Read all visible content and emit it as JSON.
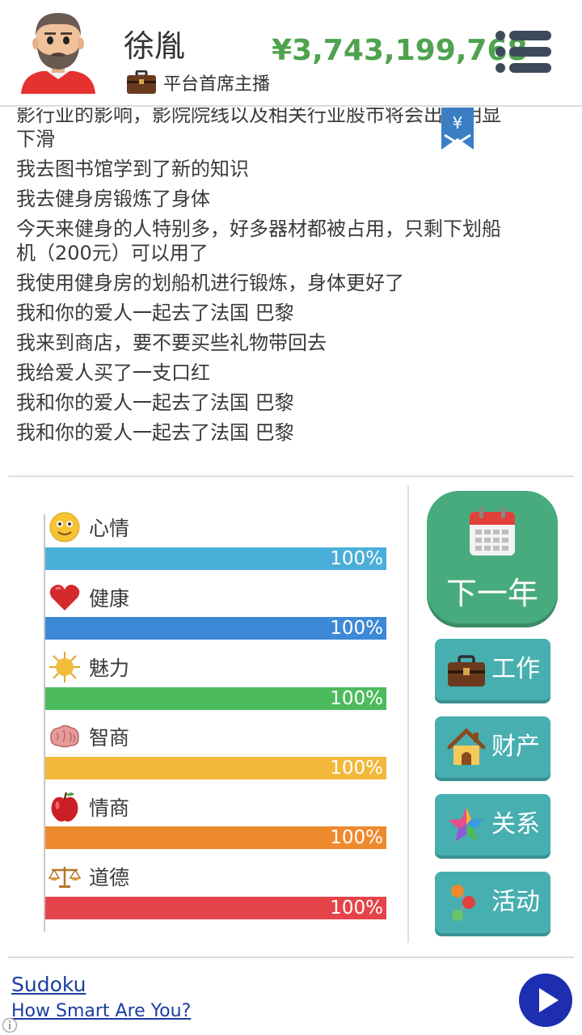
{
  "header": {
    "player_name": "徐胤",
    "job_title": "平台首席主播",
    "money": "¥3,743,199,768",
    "icons": {
      "avatar": "bearded-man-avatar",
      "briefcase": "briefcase-icon",
      "menu": "hamburger-menu-icon"
    },
    "colors": {
      "money": "#4fa34f"
    }
  },
  "log": {
    "lines": [
      "影行业的影响，影院院线以及相关行业股市将会出现明显",
      "下滑",
      "我去图书馆学到了新的知识",
      "我去健身房锻炼了身体",
      "今天来健身的人特别多，好多器材都被占用，只剩下划船",
      "机（200元）可以用了",
      "我使用健身房的划船机进行锻炼，身体更好了",
      "我和你的爱人一起去了法国 巴黎",
      "我来到商店，要不要买些礼物带回去",
      "我给爱人买了一支口红",
      "我和你的爱人一起去了法国 巴黎",
      "我和你的爱人一起去了法国 巴黎"
    ],
    "bookmark_icon": "yen-bookmark-icon"
  },
  "stats": [
    {
      "label": "心情",
      "value": "100%",
      "level": 1.0,
      "icon": "smiley-icon",
      "color": "#4aafd8"
    },
    {
      "label": "健康",
      "value": "100%",
      "level": 1.0,
      "icon": "heart-icon",
      "color": "#3e88d8"
    },
    {
      "label": "魅力",
      "value": "100%",
      "level": 1.0,
      "icon": "sun-icon",
      "color": "#4cbb5c"
    },
    {
      "label": "智商",
      "value": "100%",
      "level": 1.0,
      "icon": "brain-icon",
      "color": "#f3b83a"
    },
    {
      "label": "情商",
      "value": "100%",
      "level": 1.0,
      "icon": "apple-icon",
      "color": "#ee8a2e"
    },
    {
      "label": "道德",
      "value": "100%",
      "level": 1.0,
      "icon": "scales-icon",
      "color": "#e5444a"
    }
  ],
  "actions": {
    "next_year": "下一年",
    "work": "工作",
    "property": "财产",
    "relations": "关系",
    "activities": "活动",
    "colors": {
      "next_year": "#48ab7d",
      "side": "#47afb0"
    }
  },
  "ad": {
    "title": "Sudoku",
    "subtitle": "How Smart Are You?",
    "play_icon": "play-icon",
    "info_icon": "info-icon"
  }
}
